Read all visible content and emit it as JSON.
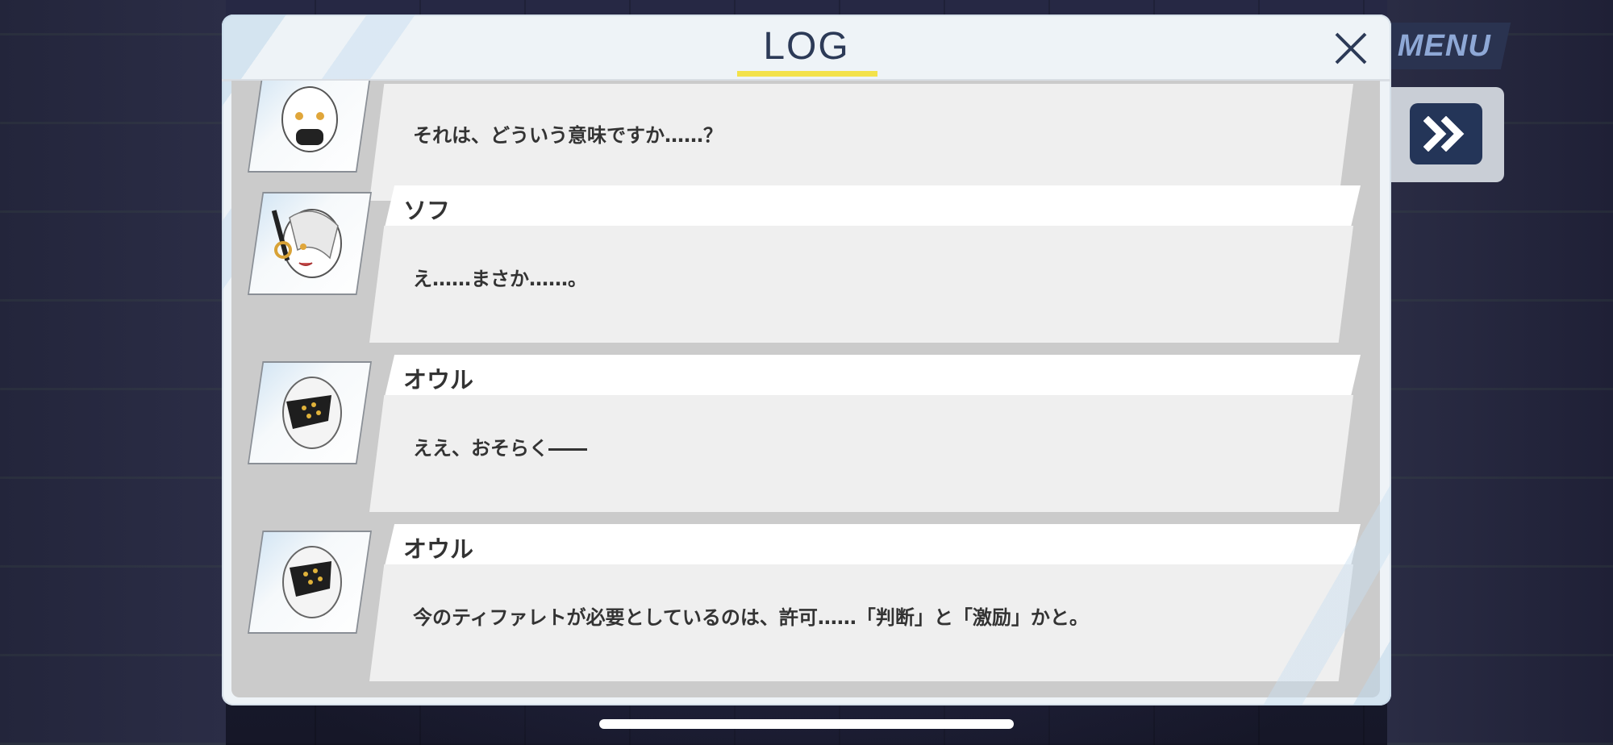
{
  "hud": {
    "menu_label": "MENU",
    "fast_forward_icon": "double-chevron-right-icon"
  },
  "log": {
    "title": "LOG",
    "close_icon": "close-icon",
    "entries": [
      {
        "name": "",
        "message": "それは、どういう意味ですか……？",
        "avatar": "girl-with-mask-avatar"
      },
      {
        "name": "ソフ",
        "message": "え……まさか……。",
        "avatar": "girl-with-headphones-avatar"
      },
      {
        "name": "オウル",
        "message": "ええ、おそらく――",
        "avatar": "girl-with-visor-avatar"
      },
      {
        "name": "オウル",
        "message": "今のティファレトが必要としているのは、許可……「判断」と「激励」かと。",
        "avatar": "girl-with-visor-avatar"
      }
    ]
  },
  "colors": {
    "accent_underline": "#f3e24a",
    "title_color": "#2c3a57",
    "hud_button": "#243558"
  }
}
